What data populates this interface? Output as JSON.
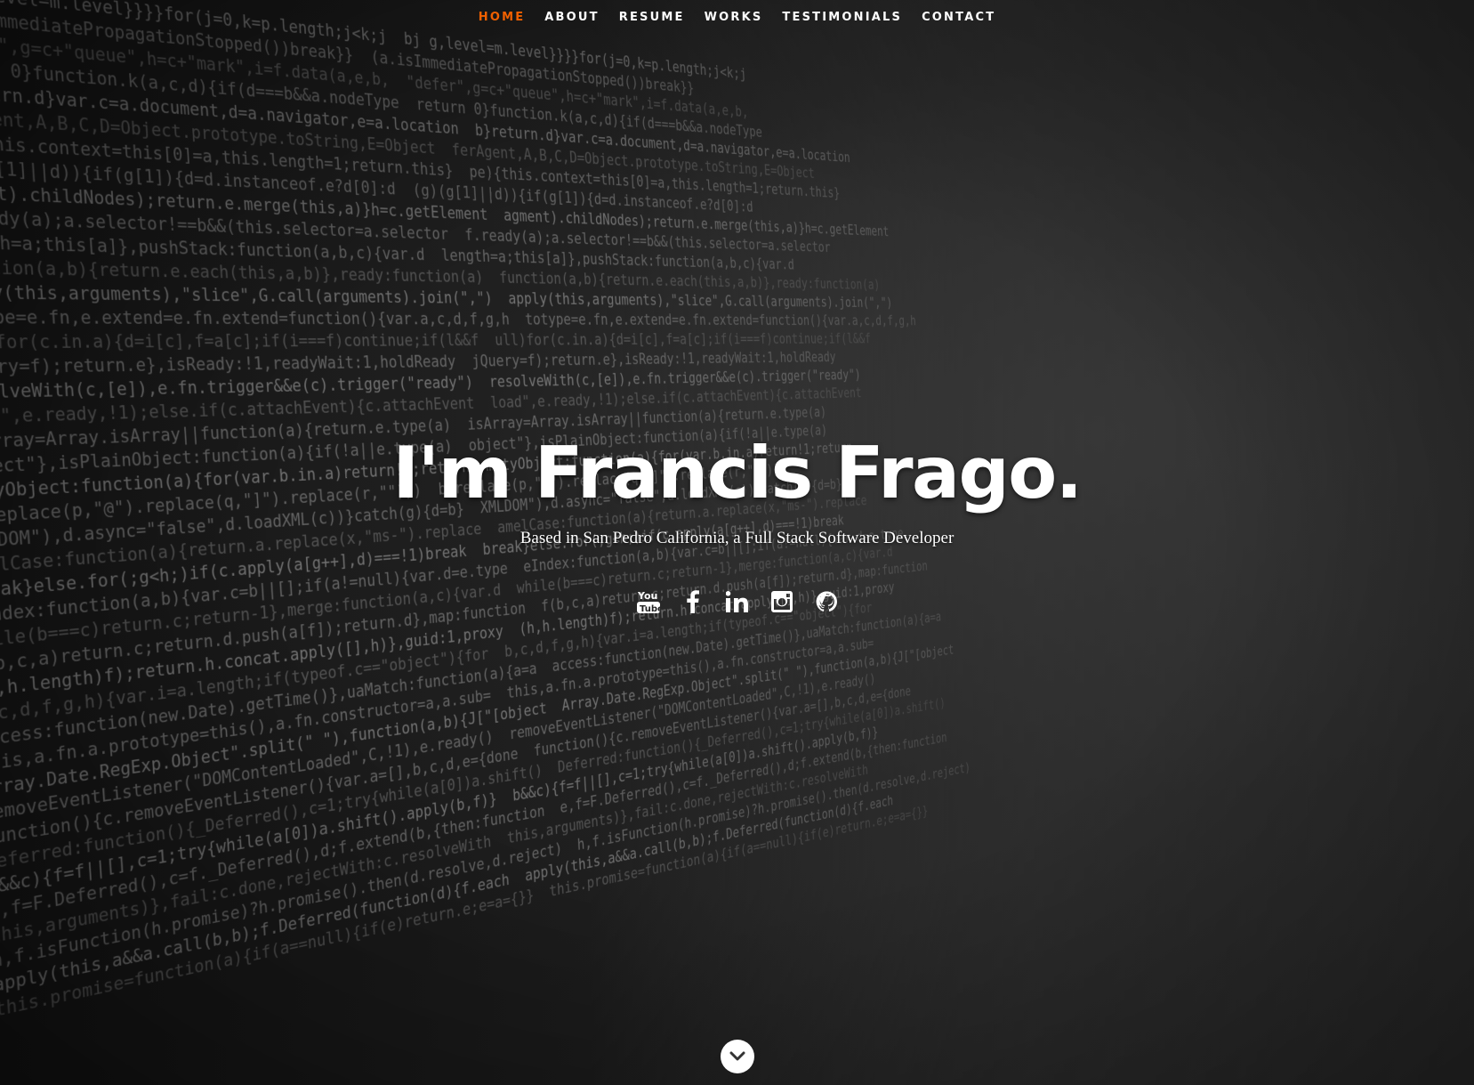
{
  "nav": {
    "items": [
      {
        "label": "HOME",
        "active": true
      },
      {
        "label": "ABOUT",
        "active": false
      },
      {
        "label": "RESUME",
        "active": false
      },
      {
        "label": "WORKS",
        "active": false
      },
      {
        "label": "TESTIMONIALS",
        "active": false
      },
      {
        "label": "CONTACT",
        "active": false
      }
    ],
    "active_color": "#F06000",
    "text_color": "#FFFFFF"
  },
  "banner": {
    "headline": "I'm Francis Frago.",
    "tagline": "Based in San Pedro California, a Full Stack Software Developer"
  },
  "social": {
    "icons": [
      "youtube-icon",
      "facebook-icon",
      "linkedin-icon",
      "instagram-icon",
      "github-icon"
    ]
  },
  "scroll": {
    "icon": "chevron-down-icon"
  }
}
